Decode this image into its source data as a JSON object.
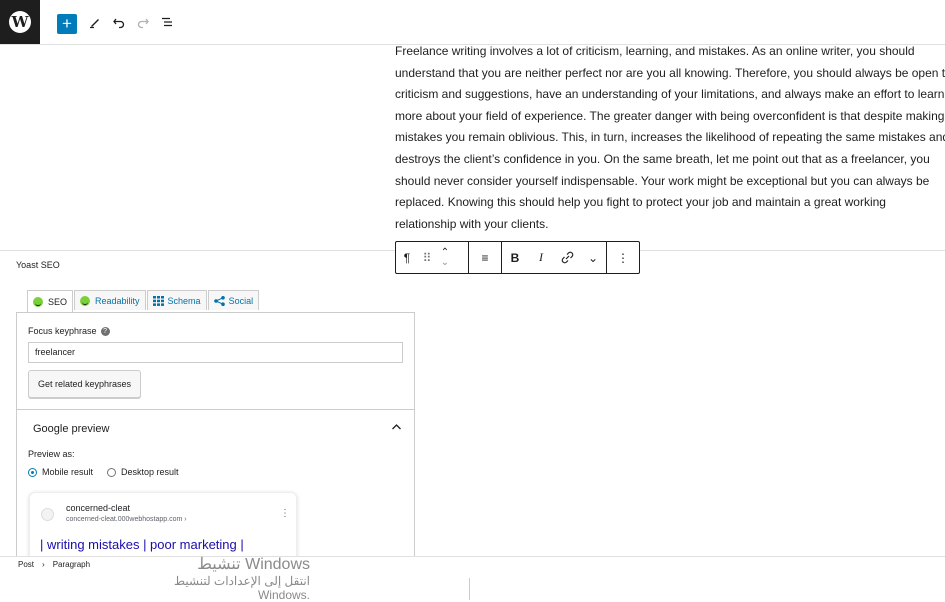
{
  "header": {
    "add_icon": "+",
    "tools_icon": "pencil-icon",
    "undo_icon": "undo-icon",
    "redo_icon": "redo-icon",
    "outline_icon": "list-view-icon"
  },
  "content": {
    "lines": [
      "Freelance writing involves a lot of criticism, learning, and mistakes. As an online writer, you should",
      "understand that you are neither perfect nor are you all knowing. Therefore, you should always be open t",
      "criticism and suggestions, have an understanding of your limitations, and always make an effort to learn",
      "more about your field of experience. The greater danger with being overconfident is that despite making",
      "mistakes you remain oblivious. This, in turn, increases the likelihood of repeating the same mistakes and",
      "destroys the client’s confidence in you. On the same breath, let me point out that as a freelancer, you",
      "should never consider yourself indispensable. Your work might be exceptional but you can always be",
      "replaced. Knowing this should help you fight to protect your job and maintain a great working",
      "relationship with your clients."
    ]
  },
  "block_toolbar": {
    "paragraph": "¶",
    "drag": "⠿",
    "up": "⌃",
    "down": "⌄",
    "align": "≡",
    "bold": "B",
    "italic": "I",
    "link": "🔗",
    "more": "⌄",
    "options": "⋮"
  },
  "yoast": {
    "title": "Yoast SEO",
    "tabs": [
      {
        "label": "SEO"
      },
      {
        "label": "Readability"
      },
      {
        "label": "Schema"
      },
      {
        "label": "Social"
      }
    ],
    "focus_keyphrase_label": "Focus keyphrase",
    "focus_keyphrase_value": "freelancer",
    "related_button": "Get related keyphrases",
    "google_preview_title": "Google preview",
    "preview_as_label": "Preview as:",
    "mobile_label": "Mobile result",
    "desktop_label": "Desktop result",
    "card": {
      "site_name": "concerned-cleat",
      "site_url": "concerned-cleat.000webhostapp.com ›",
      "title": "| writing mistakes | poor marketing |"
    }
  },
  "footer": {
    "breadcrumb": [
      "Post",
      "Paragraph"
    ],
    "watermark_line1": "تنشيط Windows",
    "watermark_line2": "انتقل إلى الإعدادات لتنشيط Windows."
  },
  "colors": {
    "accent": "#007cba",
    "dark": "#1e1e1e",
    "good": "#7ad03a",
    "link": "#0073aa",
    "serp_link": "#1a0dab"
  }
}
